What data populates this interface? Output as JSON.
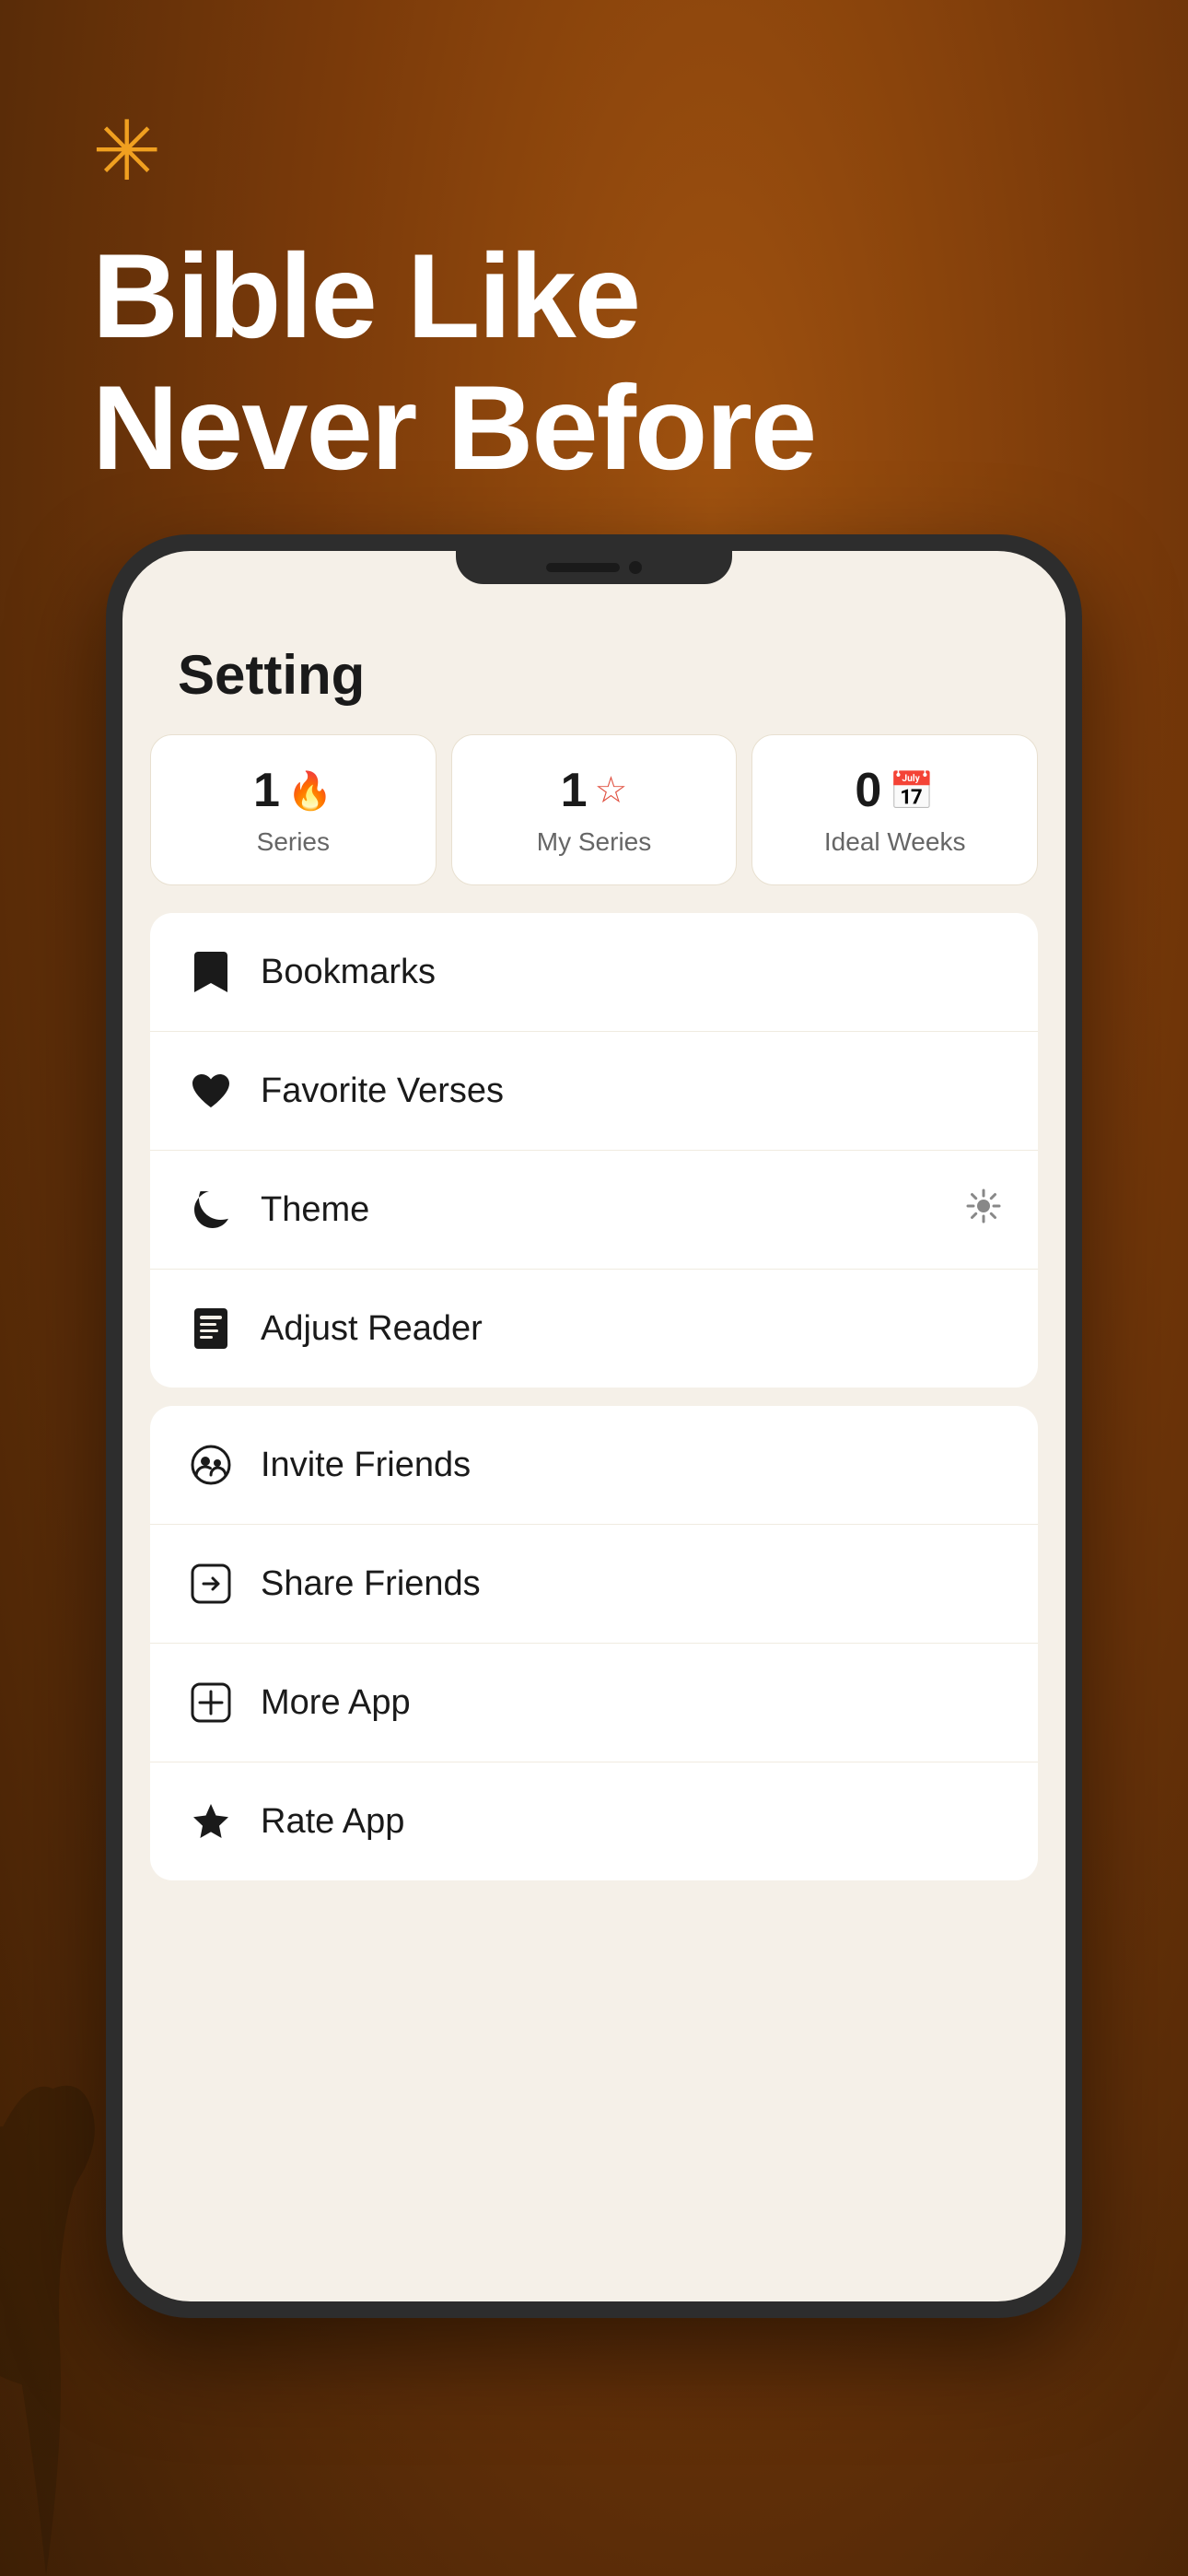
{
  "background": {
    "colors": {
      "top": "#a0520f",
      "mid": "#7a3a0a",
      "bottom": "#3d1f05"
    }
  },
  "hero": {
    "asterisk": "✳",
    "title_line1": "Bible Like",
    "title_line2": "Never Before"
  },
  "phone": {
    "header": "Setting"
  },
  "stats": [
    {
      "number": "1",
      "icon": "flame",
      "label": "Series"
    },
    {
      "number": "1",
      "icon": "star",
      "label": "My Series"
    },
    {
      "number": "0",
      "icon": "calendar",
      "label": "Ideal Weeks"
    }
  ],
  "menu_section1": {
    "items": [
      {
        "id": "bookmarks",
        "icon": "bookmark",
        "label": "Bookmarks",
        "right": ""
      },
      {
        "id": "favorite-verses",
        "icon": "heart",
        "label": "Favorite Verses",
        "right": ""
      },
      {
        "id": "theme",
        "icon": "moon",
        "label": "Theme",
        "right": "sun"
      },
      {
        "id": "adjust-reader",
        "icon": "book",
        "label": "Adjust Reader",
        "right": ""
      }
    ]
  },
  "menu_section2": {
    "items": [
      {
        "id": "invite-friends",
        "icon": "people",
        "label": "Invite Friends",
        "right": ""
      },
      {
        "id": "share-friends",
        "icon": "share",
        "label": "Share Friends",
        "right": ""
      },
      {
        "id": "more-app",
        "icon": "plus-box",
        "label": "More App",
        "right": ""
      },
      {
        "id": "rate-app",
        "icon": "star-fill",
        "label": "Rate App",
        "right": ""
      }
    ]
  }
}
